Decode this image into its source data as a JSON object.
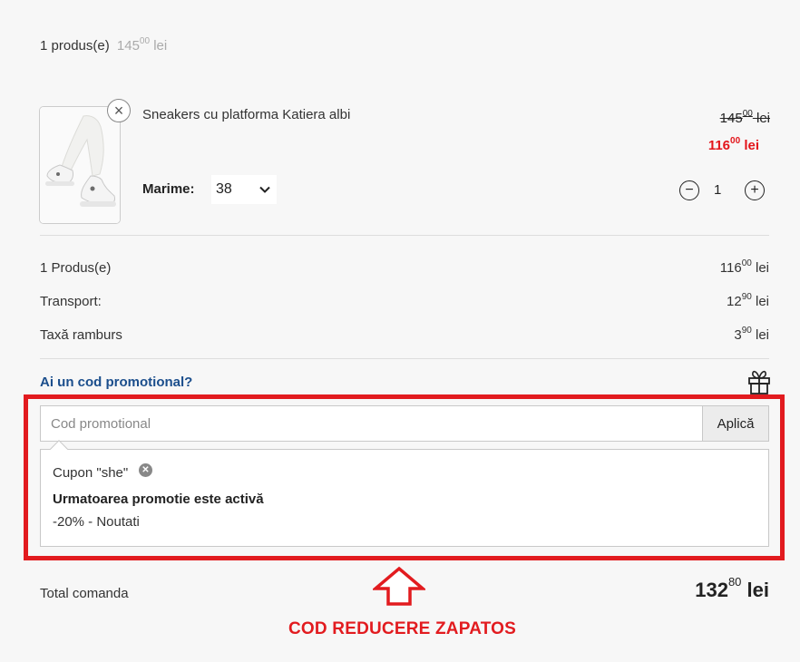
{
  "cart_summary": {
    "count_label": "1 produs(e)",
    "price_int": "145",
    "price_dec": "00",
    "currency": "lei"
  },
  "product": {
    "name": "Sneakers cu platforma Katiera albi",
    "old_price_int": "145",
    "old_price_dec": "00",
    "new_price_int": "116",
    "new_price_dec": "00",
    "currency": "lei",
    "size_label": "Marime:",
    "size_value": "38",
    "quantity": "1",
    "remove_icon": "close-icon",
    "image_icon": "sneaker-photo"
  },
  "totals": {
    "products": {
      "label": "1 Produs(e)",
      "int": "116",
      "dec": "00",
      "currency": "lei"
    },
    "transport": {
      "label": "Transport:",
      "int": "12",
      "dec": "90",
      "currency": "lei"
    },
    "cod_fee": {
      "label": "Taxă ramburs",
      "int": "3",
      "dec": "90",
      "currency": "lei"
    }
  },
  "promo": {
    "toggle_label": "Ai un cod promotional?",
    "gift_icon": "gift-icon",
    "input_placeholder": "Cod promotional",
    "apply_label": "Aplică",
    "coupon_label": "Cupon \"she\"",
    "active_message": "Urmatoarea promotie este activă",
    "detail": "-20% - Noutati"
  },
  "order_total": {
    "label": "Total comanda",
    "int": "132",
    "dec": "80",
    "currency": "lei"
  },
  "annotation": {
    "text": "COD REDUCERE ZAPATOS",
    "arrow_icon": "arrow-up-icon"
  },
  "colors": {
    "sale_red": "#e3151b",
    "link_blue": "#1b4e8c",
    "highlight_red": "#e21b1f"
  }
}
